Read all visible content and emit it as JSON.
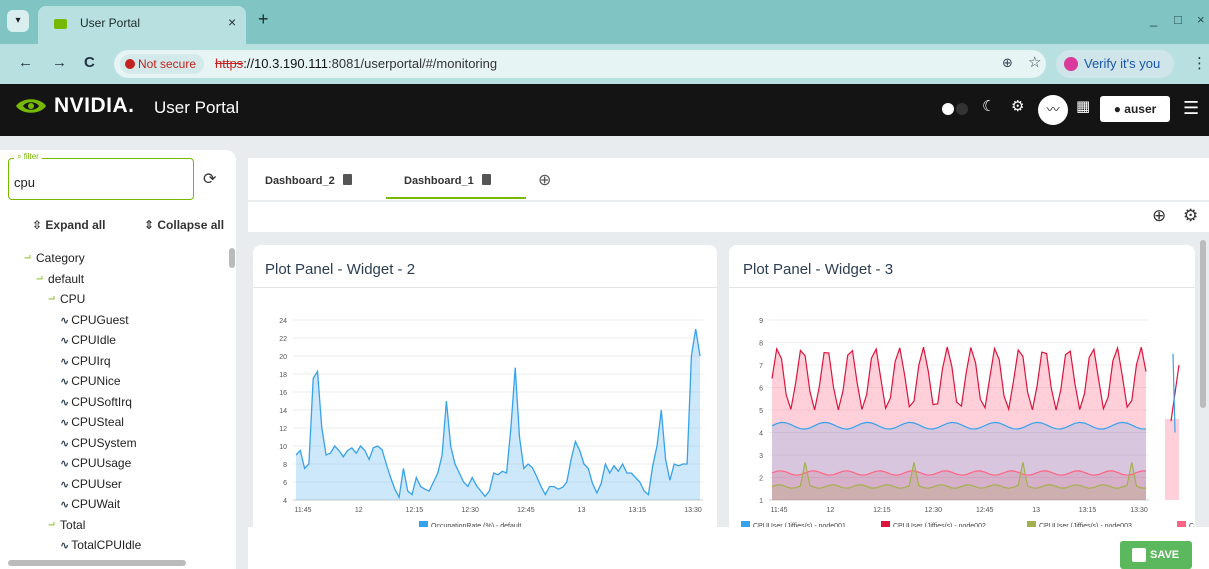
{
  "browser": {
    "tab_title": "User Portal",
    "tab_close": "×",
    "new_tab": "+",
    "window_controls": [
      "_",
      "□",
      "×"
    ],
    "nav": {
      "back": "←",
      "forward": "→",
      "reload": "C"
    },
    "not_secure": "Not secure",
    "url_proto": "https",
    "url_host": "://10.3.190.111",
    "url_rest": ":8081/userportal/#/monitoring",
    "zoom_icon": "zoom-icon",
    "verify_label": "Verify it's you",
    "menu": "⋮"
  },
  "header": {
    "logo_text": "NVIDIA.",
    "title": "User Portal",
    "user_label": "auser",
    "icons": [
      "theme-light-dot-icon",
      "moon-icon",
      "settings-icon",
      "chart-icon",
      "calculator-icon",
      "user-icon",
      "menu-icon"
    ],
    "accent": "#76b900"
  },
  "sidebar": {
    "filter_label": "filter",
    "filter_value": "cpu",
    "expand_all": "Expand all",
    "collapse_all": "Collapse all",
    "tree": [
      {
        "label": "Category",
        "level": 0,
        "type": "branch"
      },
      {
        "label": "default",
        "level": 1,
        "type": "branch"
      },
      {
        "label": "CPU",
        "level": 2,
        "type": "branch"
      },
      {
        "label": "CPUGuest",
        "level": 3,
        "type": "metric"
      },
      {
        "label": "CPUIdle",
        "level": 3,
        "type": "metric"
      },
      {
        "label": "CPUIrq",
        "level": 3,
        "type": "metric"
      },
      {
        "label": "CPUNice",
        "level": 3,
        "type": "metric"
      },
      {
        "label": "CPUSoftIrq",
        "level": 3,
        "type": "metric"
      },
      {
        "label": "CPUSteal",
        "level": 3,
        "type": "metric"
      },
      {
        "label": "CPUSystem",
        "level": 3,
        "type": "metric"
      },
      {
        "label": "CPUUsage",
        "level": 3,
        "type": "metric"
      },
      {
        "label": "CPUUser",
        "level": 3,
        "type": "metric"
      },
      {
        "label": "CPUWait",
        "level": 3,
        "type": "metric"
      },
      {
        "label": "Total",
        "level": 2,
        "type": "branch"
      },
      {
        "label": "TotalCPUIdle",
        "level": 3,
        "type": "metric"
      }
    ]
  },
  "dashboards": {
    "tabs": [
      {
        "label": "Dashboard_2",
        "active": false
      },
      {
        "label": "Dashboard_1",
        "active": true
      }
    ],
    "add_tab": "⊕",
    "add_widget": "⊕",
    "settings": "⚙"
  },
  "panels": [
    {
      "title": "Plot Panel - Widget - 2"
    },
    {
      "title": "Plot Panel - Widget - 3"
    }
  ],
  "footer": {
    "save_label": "SAVE",
    "save_color": "#5cb85c"
  },
  "chart_data": [
    {
      "type": "area",
      "x": [
        "11:45",
        "12",
        "12:15",
        "12:30",
        "12:45",
        "13",
        "13:15",
        "13:30"
      ],
      "ylim": [
        4,
        24
      ],
      "yticks": [
        4,
        6,
        8,
        10,
        12,
        14,
        16,
        18,
        20,
        22,
        24
      ],
      "series": [
        {
          "name": "OccupationRate (%) - default",
          "color": "#36a2eb",
          "values": [
            9,
            9.5,
            7.5,
            8,
            17.5,
            18.3,
            12,
            9,
            9.2,
            10,
            9.5,
            8.8,
            9.5,
            9.8,
            9.2,
            10,
            9.5,
            8.5,
            9.8,
            10,
            9.6,
            8,
            6.5,
            5.2,
            4.3,
            7.5,
            5,
            4.6,
            6.5,
            5.5,
            5.2,
            5,
            6,
            7,
            9,
            15,
            10,
            8,
            7,
            6,
            5.5,
            6.5,
            5.6,
            5,
            4.4,
            5,
            7,
            6.8,
            7.2,
            7,
            12,
            18.7,
            11,
            7.5,
            8,
            7.6,
            6.6,
            5.5,
            4.6,
            5.5,
            5.5,
            5.2,
            5.4,
            6,
            8.5,
            10.5,
            9.5,
            8,
            7.5,
            5.8,
            4.8,
            5.8,
            8,
            7,
            7.8,
            7.2,
            8,
            7,
            7,
            6.5,
            6,
            5,
            4.6,
            7.8,
            10,
            14,
            8.5,
            6.2,
            8,
            7.8,
            8,
            8,
            20,
            23,
            20
          ]
        }
      ]
    },
    {
      "type": "area",
      "x": [
        "11:45",
        "12",
        "12:15",
        "12:30",
        "12:45",
        "13",
        "13:15",
        "13:30"
      ],
      "ylim": [
        1,
        9
      ],
      "yticks": [
        1,
        2,
        3,
        4,
        5,
        6,
        7,
        8,
        9
      ],
      "series": [
        {
          "name": "CPUUser (Jiffies/s) - node001",
          "color": "#36a2eb",
          "approx_level": 4.3
        },
        {
          "name": "CPUUser (Jiffies/s) - node002",
          "color": "#dc143c",
          "approx_min": 5.0,
          "approx_max": 7.8
        },
        {
          "name": "CPUUser (Jiffies/s) - node003",
          "color": "#a4b050",
          "approx_level": 1.6
        },
        {
          "name": "C",
          "color": "#ff6384",
          "approx_level": 2.2
        }
      ]
    }
  ]
}
